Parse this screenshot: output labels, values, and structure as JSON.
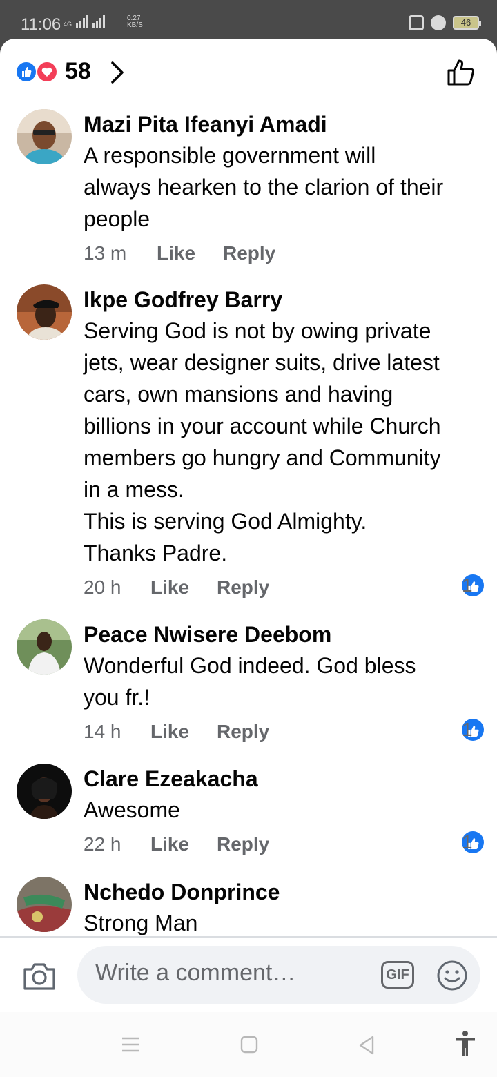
{
  "status_bar": {
    "time": "11:06",
    "network_tag": "4G",
    "speed_value": "0.27",
    "speed_unit": "KB/S",
    "battery": "46"
  },
  "header": {
    "reaction_count": "58",
    "reactions": [
      "like",
      "love"
    ]
  },
  "comments": [
    {
      "author": "Mazi Pita Ifeanyi Amadi",
      "text": "A responsible government will\nalways hearken to the clarion of their\npeople",
      "time": "13 m",
      "like_label": "Like",
      "reply_label": "Reply",
      "likes": ""
    },
    {
      "author": "Ikpe Godfrey Barry",
      "text": "Serving God is not by owing private\njets, wear designer suits, drive latest\ncars, own mansions and having\nbillions in your account while Church\nmembers go hungry and Community\nin a mess.\nThis is serving God Almighty.\nThanks Padre.",
      "time": "20 h",
      "like_label": "Like",
      "reply_label": "Reply",
      "likes": "1"
    },
    {
      "author": "Peace Nwisere Deebom",
      "text": "Wonderful God indeed. God bless\nyou fr.!",
      "time": "14 h",
      "like_label": "Like",
      "reply_label": "Reply",
      "likes": "1"
    },
    {
      "author": "Clare Ezeakacha",
      "text": "Awesome",
      "time": "22 h",
      "like_label": "Like",
      "reply_label": "Reply",
      "likes": "1"
    },
    {
      "author": "Nchedo Donprince",
      "text": "Strong Man",
      "time": "",
      "like_label": "",
      "reply_label": "",
      "likes": ""
    }
  ],
  "composer": {
    "placeholder": "Write a comment…",
    "gif_label": "GIF"
  },
  "colors": {
    "accent": "#1877f2",
    "love": "#f33e58",
    "meta_text": "#65676b"
  }
}
